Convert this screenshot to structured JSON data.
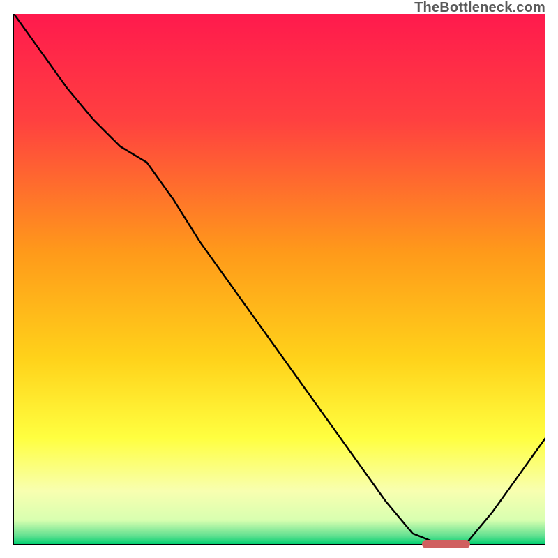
{
  "watermark": "TheBottleneck.com",
  "chart_data": {
    "type": "line",
    "title": "",
    "xlabel": "",
    "ylabel": "",
    "x": [
      0.0,
      0.05,
      0.1,
      0.15,
      0.2,
      0.25,
      0.3,
      0.35,
      0.4,
      0.45,
      0.5,
      0.55,
      0.6,
      0.65,
      0.7,
      0.75,
      0.8,
      0.82,
      0.85,
      0.9,
      0.95,
      1.0
    ],
    "values": [
      1.0,
      0.93,
      0.86,
      0.8,
      0.75,
      0.72,
      0.65,
      0.57,
      0.5,
      0.43,
      0.36,
      0.29,
      0.22,
      0.15,
      0.08,
      0.02,
      0.0,
      0.0,
      0.0,
      0.06,
      0.13,
      0.2
    ],
    "xlim": [
      0,
      1
    ],
    "ylim": [
      0,
      1
    ],
    "optimal_marker": {
      "x_start": 0.77,
      "x_end": 0.86,
      "y": 0.0
    },
    "background_gradient": {
      "stops": [
        {
          "offset": 0.0,
          "color": "#ff1a4d"
        },
        {
          "offset": 0.2,
          "color": "#ff4040"
        },
        {
          "offset": 0.45,
          "color": "#ff9a1a"
        },
        {
          "offset": 0.65,
          "color": "#ffd21a"
        },
        {
          "offset": 0.8,
          "color": "#ffff40"
        },
        {
          "offset": 0.9,
          "color": "#f8ffb0"
        },
        {
          "offset": 0.955,
          "color": "#d8ffb0"
        },
        {
          "offset": 0.985,
          "color": "#60e090"
        },
        {
          "offset": 1.0,
          "color": "#00d070"
        }
      ]
    }
  }
}
